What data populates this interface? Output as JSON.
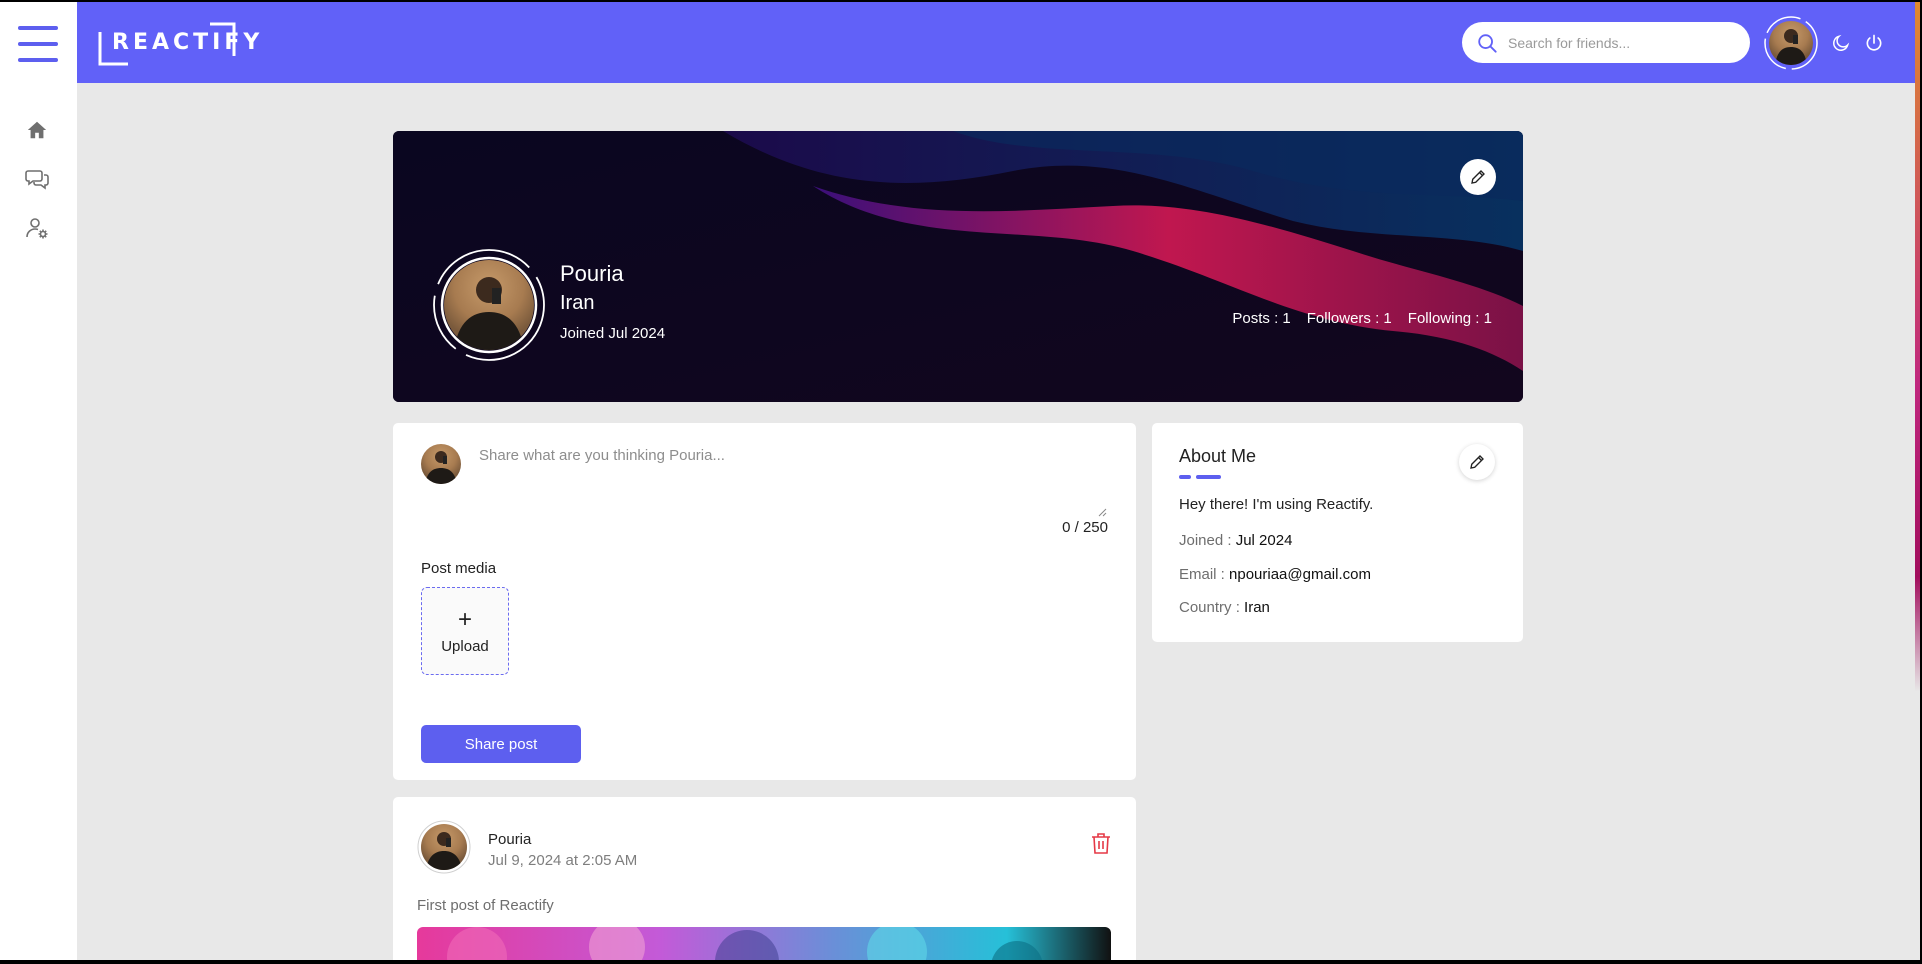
{
  "app": {
    "logo_text": "REACTIFY"
  },
  "colors": {
    "accent": "#5d5fef",
    "header": "#6161f8",
    "page_bg": "#e8e8e8",
    "danger": "#e53946"
  },
  "sidebar": {
    "items": [
      {
        "name": "home",
        "icon": "home-icon"
      },
      {
        "name": "chat",
        "icon": "chat-icon"
      },
      {
        "name": "settings",
        "icon": "user-settings-icon"
      }
    ]
  },
  "header": {
    "search": {
      "placeholder": "Search for friends..."
    },
    "icons": [
      "moon-icon",
      "power-icon"
    ]
  },
  "profile": {
    "name": "Pouria",
    "country": "Iran",
    "joined": "Joined Jul 2024",
    "stats": {
      "posts": "Posts : 1",
      "followers": "Followers : 1",
      "following": "Following : 1"
    }
  },
  "composer": {
    "placeholder": "Share what are you thinking Pouria...",
    "counter": "0 / 250",
    "media_label": "Post media",
    "upload_label": "Upload",
    "upload_plus": "+",
    "share_label": "Share post"
  },
  "about": {
    "title": "About Me",
    "bio": "Hey there! I'm using Reactify.",
    "joined_label": "Joined : ",
    "joined_value": "Jul 2024",
    "email_label": "Email : ",
    "email_value": "npouriaa@gmail.com",
    "country_label": "Country : ",
    "country_value": "Iran"
  },
  "feed": {
    "posts": [
      {
        "author": "Pouria",
        "time": "Jul 9, 2024 at 2:05 AM",
        "text": "First post of Reactify"
      }
    ]
  }
}
